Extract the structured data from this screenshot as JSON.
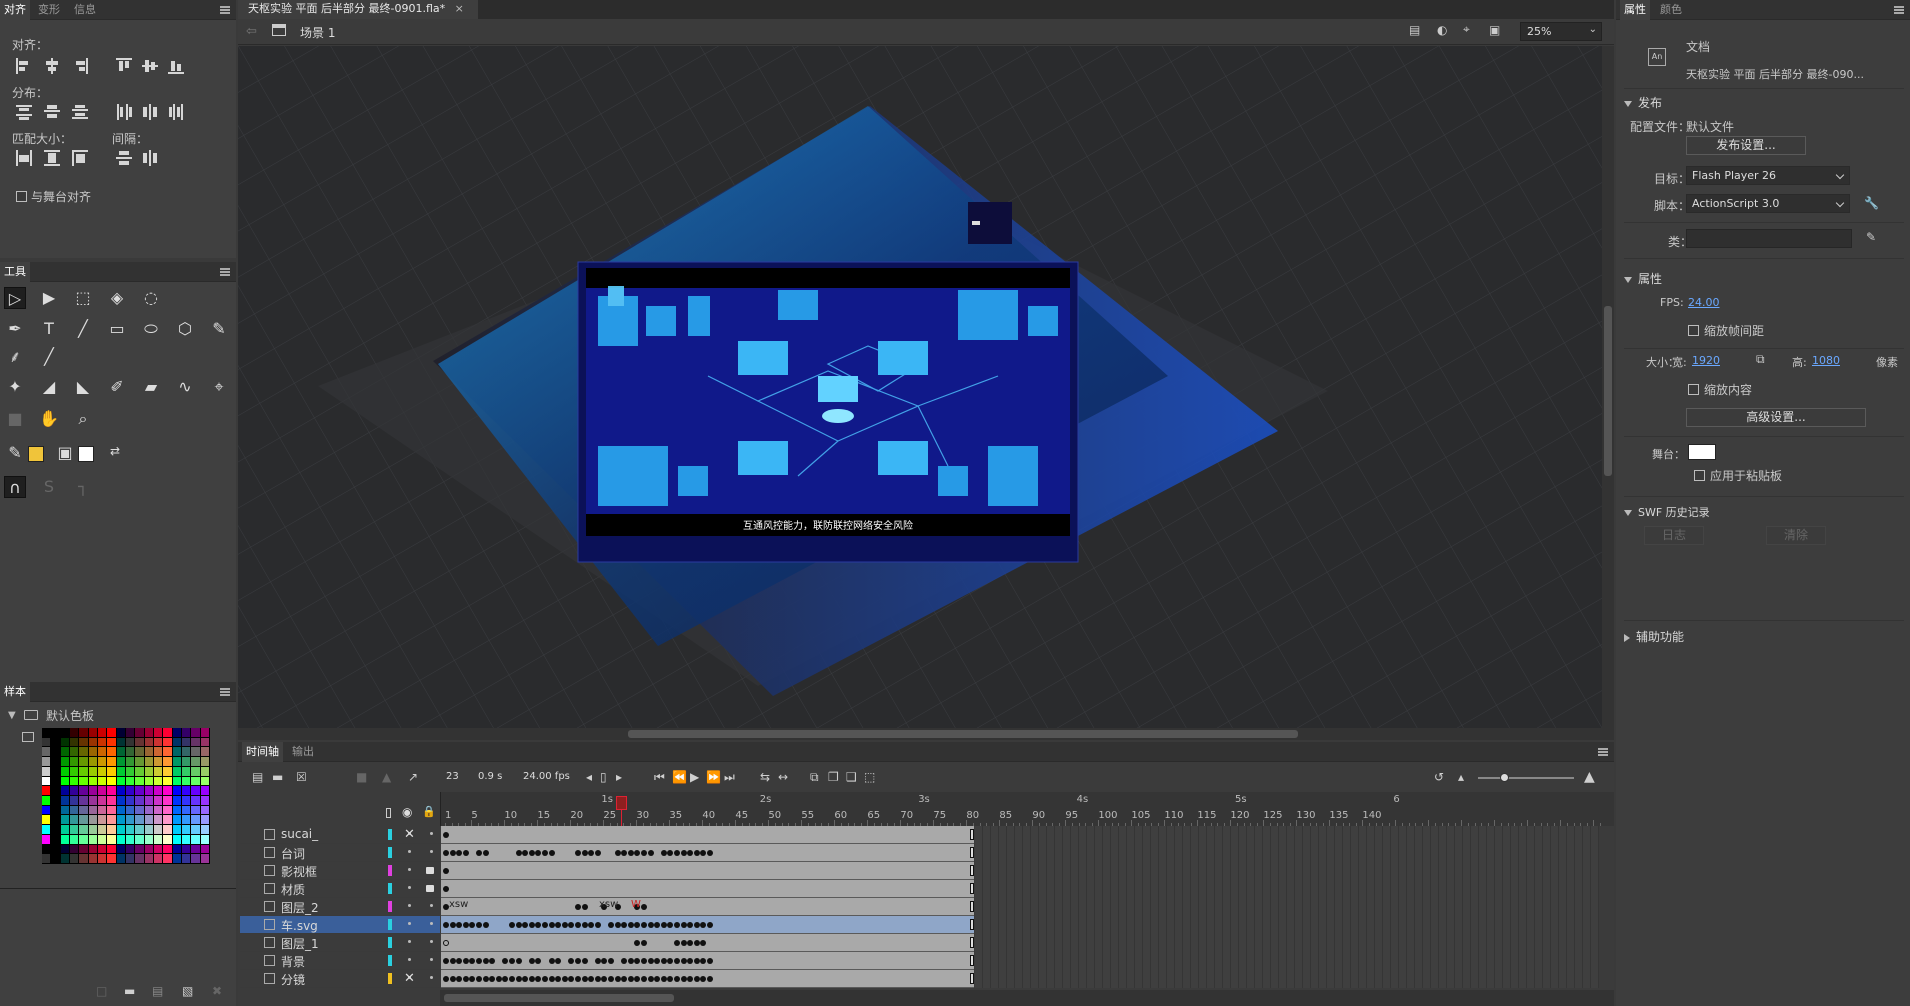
{
  "align_panel": {
    "tabs": [
      "对齐",
      "变形",
      "信息"
    ],
    "align_label": "对齐：",
    "distribute_label": "分布：",
    "match_size_label": "匹配大小：",
    "spacing_label": "间隔：",
    "stage_align_label": "与舞台对齐"
  },
  "tools_panel": {
    "title": "工具"
  },
  "swatches_panel": {
    "title": "样本",
    "folder_label": "默认色板"
  },
  "document_tab": {
    "title": "天枢实验 平面 后半部分 最终-0901.fla*",
    "close": "×"
  },
  "stage_toolbar": {
    "scene_label": "场景 1",
    "zoom": "25%"
  },
  "stage": {
    "caption": "互通风控能力，联防联控网络安全风险"
  },
  "timeline": {
    "tabs": [
      "时间轴",
      "输出"
    ],
    "current_frame": "23",
    "elapsed": "0.9 s",
    "fps": "24.00 fps",
    "ruler_numbers": [
      "1",
      "5",
      "10",
      "15",
      "20",
      "25",
      "30",
      "35",
      "40",
      "45",
      "50",
      "55",
      "60",
      "65",
      "70",
      "75",
      "80",
      "85",
      "90",
      "95",
      "100",
      "105",
      "110",
      "115",
      "120",
      "125",
      "130",
      "135",
      "140"
    ],
    "ruler_seconds": [
      "1s",
      "2s",
      "3s",
      "4s",
      "5s",
      "6"
    ],
    "layers": [
      {
        "name": "sucai_",
        "color": "#2ad0e0",
        "selected": false
      },
      {
        "name": "台词",
        "color": "#2ad0e0",
        "selected": false
      },
      {
        "name": "影视框",
        "color": "#e040e0",
        "selected": false
      },
      {
        "name": "材质",
        "color": "#2ad0e0",
        "selected": false
      },
      {
        "name": "图层_2",
        "color": "#e040e0",
        "selected": false
      },
      {
        "name": "车.svg",
        "color": "#2ad0e0",
        "selected": true
      },
      {
        "name": "图层_1",
        "color": "#2ad0e0",
        "selected": false
      },
      {
        "name": "背景",
        "color": "#2ad0e0",
        "selected": false
      },
      {
        "name": "分镜",
        "color": "#f0c020",
        "selected": false
      }
    ],
    "frame_labels": {
      "layer5_a": "xsw",
      "layer5_b": "xsw",
      "layer5_c": "W"
    }
  },
  "properties": {
    "tabs": [
      "属性",
      "颜色"
    ],
    "doc_type": "文档",
    "doc_name": "天枢实验 平面 后半部分 最终-090...",
    "publish_section": "发布",
    "profile_label": "配置文件：",
    "profile_value": "默认文件",
    "publish_settings_btn": "发布设置...",
    "target_label": "目标：",
    "target_value": "Flash Player 26",
    "script_label": "脚本：",
    "script_value": "ActionScript 3.0",
    "class_label": "类：",
    "attributes_section": "属性",
    "fps_label": "FPS:",
    "fps_value": "24.00",
    "scale_spans_label": "缩放帧间距",
    "size_label": "大小：",
    "width_label": "宽:",
    "width_value": "1920",
    "height_label": "高:",
    "height_value": "1080",
    "unit_label": "像素",
    "scale_content_label": "缩放内容",
    "advanced_btn": "高级设置...",
    "stage_label": "舞台：",
    "stage_color": "#ffffff",
    "pasteboard_label": "应用于粘贴板",
    "swf_history_section": "SWF 历史记录",
    "log_btn": "日志",
    "clear_btn": "清除",
    "accessibility_section": "辅助功能"
  }
}
